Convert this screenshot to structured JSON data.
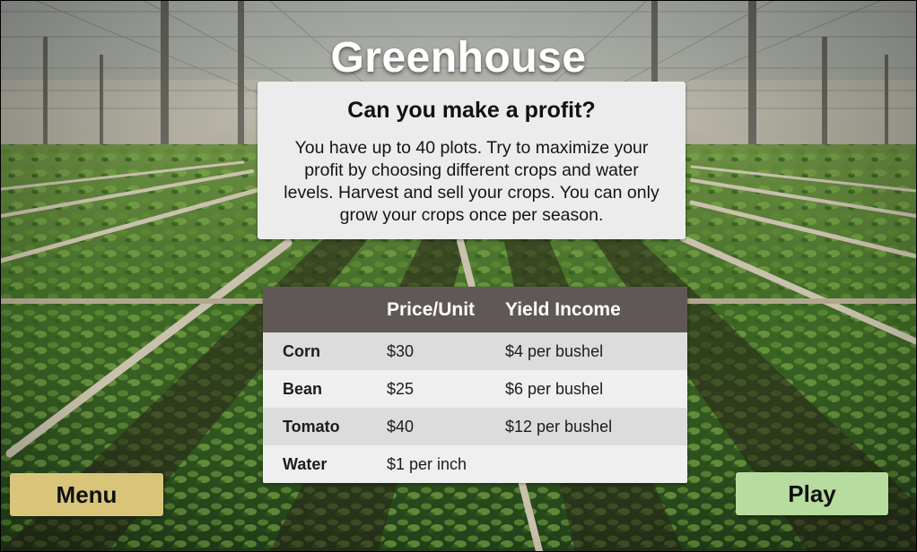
{
  "game": {
    "title": "Greenhouse"
  },
  "info_panel": {
    "heading": "Can you make a profit?",
    "body": "You have up to 40 plots. Try to maximize your profit by choosing different crops and water levels.  Harvest and sell your crops. You can only grow your crops once per season."
  },
  "crop_table": {
    "headers": [
      "",
      "Price/Unit",
      "Yield Income"
    ],
    "rows": [
      {
        "item": "Corn",
        "price": "$30",
        "yield": "$4 per bushel"
      },
      {
        "item": "Bean",
        "price": "$25",
        "yield": "$6 per bushel"
      },
      {
        "item": "Tomato",
        "price": "$40",
        "yield": "$12 per bushel"
      },
      {
        "item": "Water",
        "price": "$1 per inch",
        "yield": ""
      }
    ]
  },
  "buttons": {
    "menu_label": "Menu",
    "play_label": "Play"
  },
  "colors": {
    "table_header": "#5f5857",
    "menu_button": "#d9c57a",
    "play_button": "#b7dc9f",
    "panel_background": "#ececec"
  }
}
